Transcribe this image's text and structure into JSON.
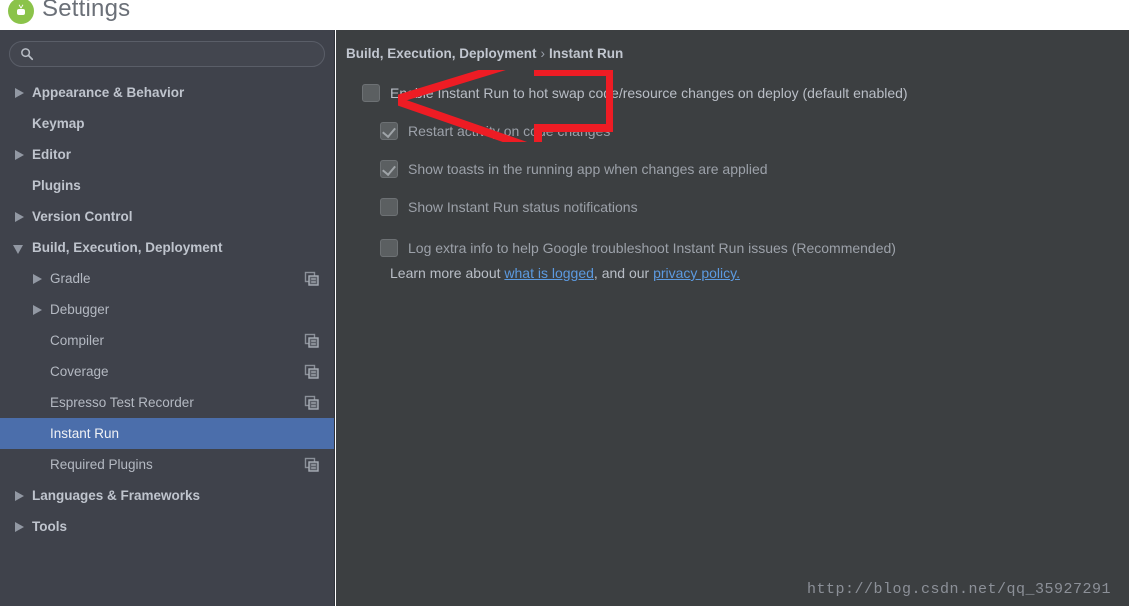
{
  "window": {
    "title": "Settings",
    "app_icon": "android-studio-icon"
  },
  "sidebar": {
    "search": {
      "placeholder": "",
      "value": "",
      "icon": "search-icon"
    },
    "items": [
      {
        "label": "Appearance & Behavior",
        "level": 0,
        "twisty": "collapsed",
        "bold": true,
        "selected": false,
        "copy_icon": false
      },
      {
        "label": "Keymap",
        "level": 0,
        "twisty": "none",
        "bold": true,
        "selected": false,
        "copy_icon": false
      },
      {
        "label": "Editor",
        "level": 0,
        "twisty": "collapsed",
        "bold": true,
        "selected": false,
        "copy_icon": false
      },
      {
        "label": "Plugins",
        "level": 0,
        "twisty": "none",
        "bold": true,
        "selected": false,
        "copy_icon": false
      },
      {
        "label": "Version Control",
        "level": 0,
        "twisty": "collapsed",
        "bold": true,
        "selected": false,
        "copy_icon": false
      },
      {
        "label": "Build, Execution, Deployment",
        "level": 0,
        "twisty": "expanded",
        "bold": true,
        "selected": false,
        "copy_icon": false
      },
      {
        "label": "Gradle",
        "level": 1,
        "twisty": "collapsed",
        "bold": false,
        "selected": false,
        "copy_icon": true
      },
      {
        "label": "Debugger",
        "level": 1,
        "twisty": "collapsed",
        "bold": false,
        "selected": false,
        "copy_icon": false
      },
      {
        "label": "Compiler",
        "level": 1,
        "twisty": "none",
        "bold": false,
        "selected": false,
        "copy_icon": true
      },
      {
        "label": "Coverage",
        "level": 1,
        "twisty": "none",
        "bold": false,
        "selected": false,
        "copy_icon": true
      },
      {
        "label": "Espresso Test Recorder",
        "level": 1,
        "twisty": "none",
        "bold": false,
        "selected": false,
        "copy_icon": true
      },
      {
        "label": "Instant Run",
        "level": 1,
        "twisty": "none",
        "bold": false,
        "selected": true,
        "copy_icon": false
      },
      {
        "label": "Required Plugins",
        "level": 1,
        "twisty": "none",
        "bold": false,
        "selected": false,
        "copy_icon": true
      },
      {
        "label": "Languages & Frameworks",
        "level": 0,
        "twisty": "collapsed",
        "bold": true,
        "selected": false,
        "copy_icon": false
      },
      {
        "label": "Tools",
        "level": 0,
        "twisty": "collapsed",
        "bold": true,
        "selected": false,
        "copy_icon": false
      }
    ]
  },
  "main": {
    "breadcrumb": {
      "parent": "Build, Execution, Deployment",
      "separator": "›",
      "current": "Instant Run"
    },
    "options": [
      {
        "label": "Enable Instant Run to hot swap code/resource changes on deploy (default enabled)",
        "checked": false,
        "indent": false,
        "dim": false
      },
      {
        "label": "Restart activity on code changes",
        "checked": true,
        "indent": true,
        "dim": true
      },
      {
        "label": "Show toasts in the running app when changes are applied",
        "checked": true,
        "indent": true,
        "dim": true
      },
      {
        "label": "Show Instant Run status notifications",
        "checked": false,
        "indent": true,
        "dim": true
      },
      {
        "label": "Log extra info to help Google troubleshoot Instant Run issues (Recommended)",
        "checked": false,
        "indent": true,
        "dim": true
      }
    ],
    "learn_more": {
      "prefix": "Learn more about ",
      "link1": "what is logged",
      "middle": ", and our ",
      "link2": "privacy policy.",
      "suffix": ""
    }
  },
  "annotation": {
    "arrow": "red-left-arrow",
    "color": "#ee1c24"
  },
  "watermark": {
    "text": "http://blog.csdn.net/qq_35927291"
  },
  "colors": {
    "sidebar_bg": "#3f424b",
    "main_bg": "#3c3f41",
    "selection": "#4b6eab",
    "link": "#5c9ae0",
    "text": "#b9bec6",
    "titlebar_bg": "#ffffff",
    "annotation_red": "#ee1c24"
  }
}
